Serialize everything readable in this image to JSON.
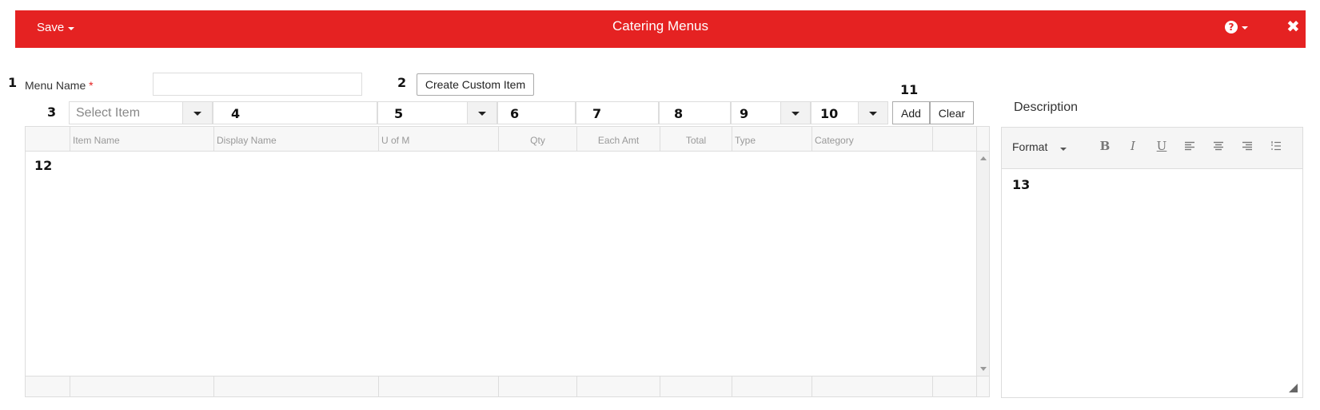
{
  "header": {
    "save_label": "Save",
    "title": "Catering Menus",
    "help_glyph": "?",
    "close_glyph": "✖",
    "accent": "#e52222"
  },
  "form": {
    "menu_name_label": "Menu Name",
    "required_mark": "*",
    "menu_name_value": "",
    "create_custom_label": "Create Custom Item"
  },
  "item_row": {
    "select_item_placeholder": "Select Item",
    "add_label": "Add",
    "clear_label": "Clear"
  },
  "grid": {
    "columns": [
      "Item Name",
      "Display Name",
      "U of M",
      "Qty",
      "Each Amt",
      "Total",
      "Type",
      "Category"
    ],
    "rows": []
  },
  "description": {
    "label": "Description",
    "format_label": "Format"
  },
  "markers": [
    "1",
    "2",
    "3",
    "4",
    "5",
    "6",
    "7",
    "8",
    "9",
    "10",
    "11",
    "12",
    "13"
  ]
}
